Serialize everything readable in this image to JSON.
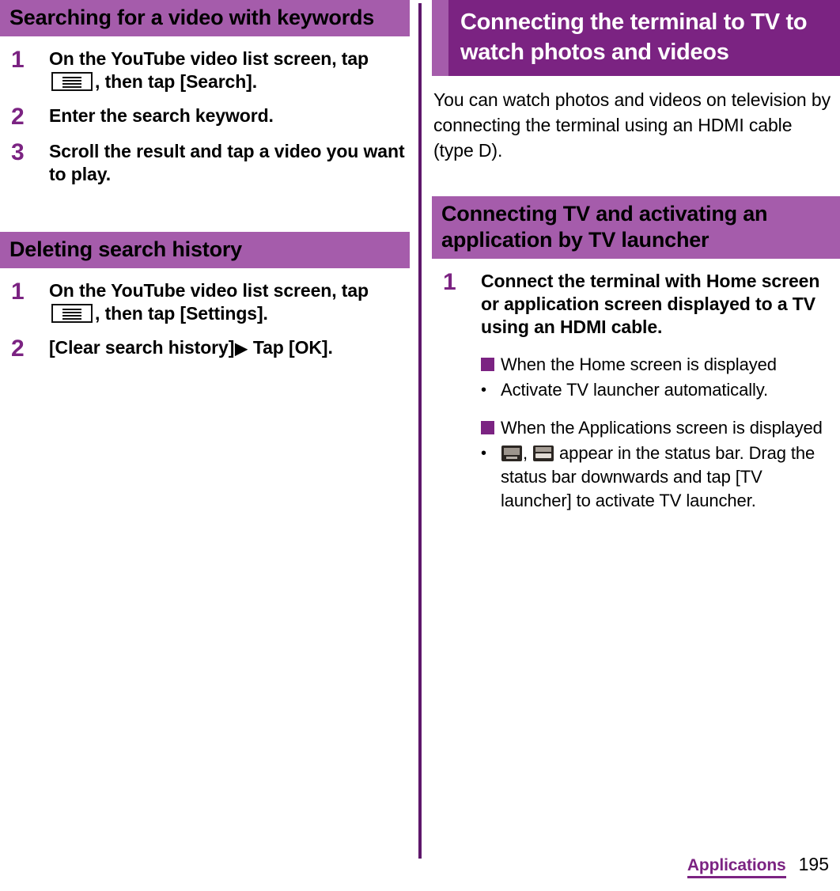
{
  "colors": {
    "heading_light": "#A55CAB",
    "heading_dark": "#7B2382",
    "divider": "#5E176B",
    "step_number": "#7B2382",
    "text": "#000000"
  },
  "left_column": {
    "sections": [
      {
        "heading": "Searching for a video with keywords",
        "steps": [
          {
            "number": "1",
            "text_before_icon": "On the YouTube video list screen, tap ",
            "icon": "menu-icon",
            "text_after_icon": ", then tap [Search]."
          },
          {
            "number": "2",
            "text": "Enter the search keyword."
          },
          {
            "number": "3",
            "text": "Scroll the result and tap a video you want to play."
          }
        ]
      },
      {
        "heading": "Deleting search history",
        "steps": [
          {
            "number": "1",
            "text_before_icon": "On the YouTube video list screen, tap ",
            "icon": "menu-icon",
            "text_after_icon": ", then tap [Settings]."
          },
          {
            "number": "2",
            "text_before_arrow": "[Clear search history]",
            "arrow": "▶",
            "text_after_arrow": " Tap [OK]."
          }
        ]
      }
    ]
  },
  "right_column": {
    "main_heading": "Connecting the terminal to TV to watch photos and videos",
    "intro_paragraph": "You can watch photos and videos on television by connecting the terminal using an HDMI cable (type D).",
    "section_heading": "Connecting TV and activating an application by TV launcher",
    "steps": [
      {
        "number": "1",
        "text": "Connect the terminal with Home screen or application screen displayed to a TV using an HDMI cable."
      }
    ],
    "subblocks": [
      {
        "square_heading": "When the Home screen is displayed",
        "bullets": [
          {
            "marker": "•",
            "text": "Activate TV launcher automatically."
          }
        ]
      },
      {
        "square_heading": "When the Applications screen is displayed",
        "bullets": [
          {
            "marker": "•",
            "icon_1": "tv-status-icon",
            "separator": ", ",
            "icon_2": "hdmi-status-icon",
            "text_after_icons": " appear in the status bar. Drag the status bar downwards and tap [TV launcher] to activate TV launcher."
          }
        ]
      }
    ]
  },
  "footer": {
    "chapter": "Applications",
    "page_number": "195"
  }
}
